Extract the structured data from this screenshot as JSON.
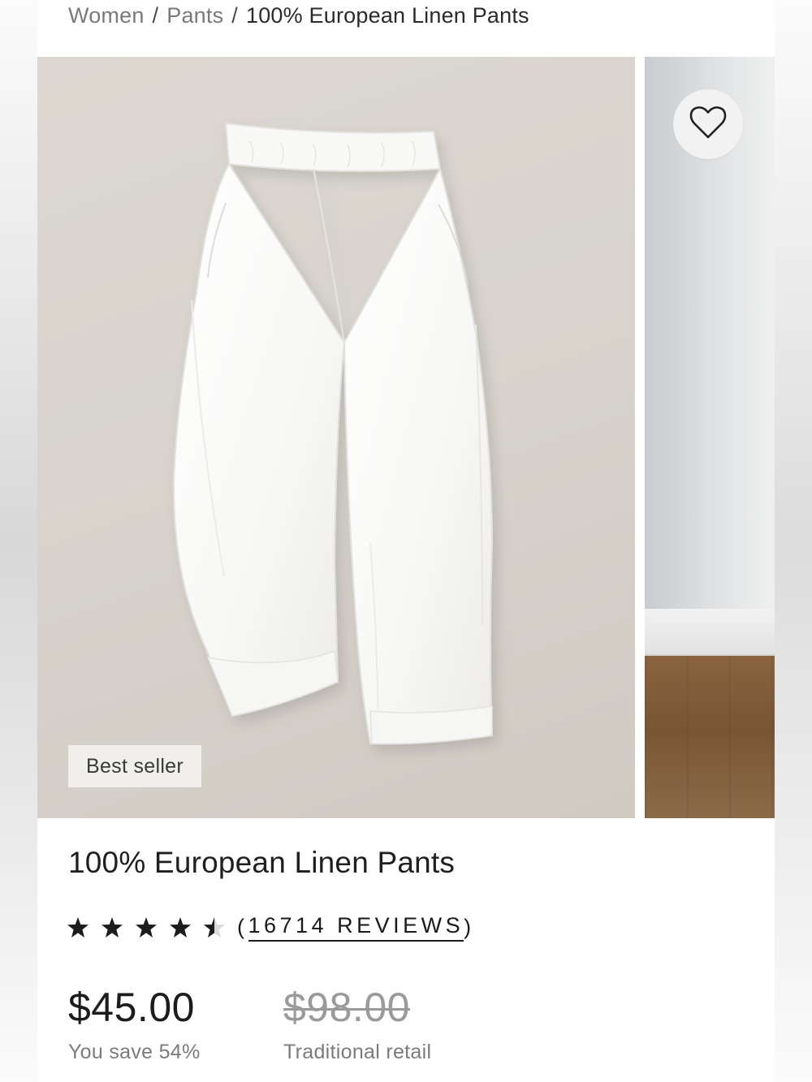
{
  "breadcrumb": {
    "items": [
      {
        "label": "Women"
      },
      {
        "label": "Pants"
      }
    ],
    "separator": "/",
    "current": "100% European Linen Pants"
  },
  "gallery": {
    "badge": "Best seller",
    "favorite_icon": "heart-icon",
    "background_color": "#d8d4cd",
    "product_color": "#ffffff"
  },
  "product": {
    "title": "100% European Linen Pants",
    "rating": {
      "value": 4.5,
      "max": 5,
      "open_paren": "(",
      "reviews_label": "16714 REVIEWS",
      "close_paren": ")"
    },
    "price": {
      "current": "$45.00",
      "savings": "You save 54%",
      "original": "$98.00",
      "original_label": "Traditional retail"
    }
  }
}
